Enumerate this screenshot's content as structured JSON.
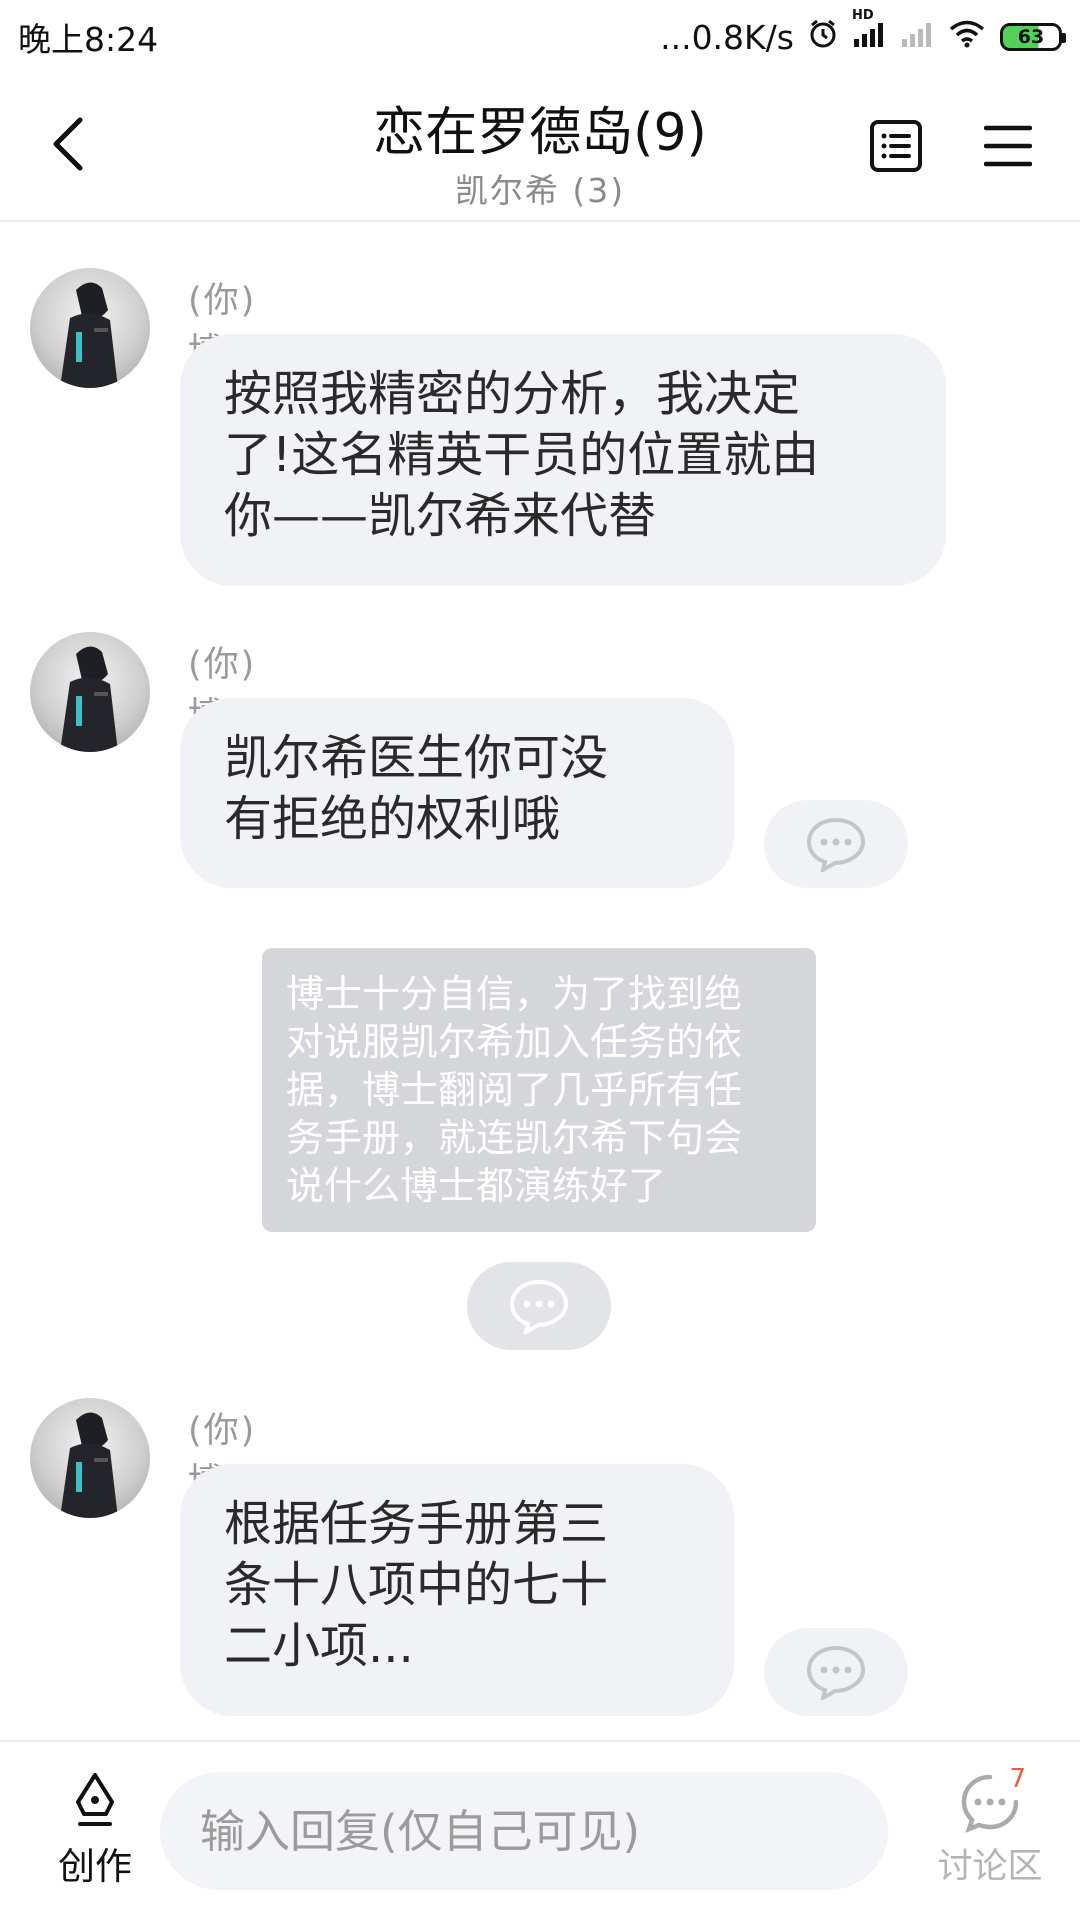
{
  "status_bar": {
    "time": "晚上8:24",
    "network_speed": "...0.8K/s",
    "signal_tag": "HD",
    "battery": "63"
  },
  "header": {
    "title": "恋在罗德岛(9)",
    "subtitle": "凯尔希 (3)",
    "icons": {
      "back": "back-arrow-icon",
      "list": "list-icon",
      "menu": "menu-icon"
    }
  },
  "messages": [
    {
      "sender": "(你) 博士",
      "text_lines": [
        "按照我精密的分析，我决定",
        "了!这名精英干员的位置就由",
        "你——凯尔希来代替"
      ]
    },
    {
      "sender": "(你) 博士",
      "text_lines": [
        "凯尔希医生你可没",
        "有拒绝的权利哦"
      ]
    },
    {
      "sender": "(你) 博士",
      "text_lines": [
        "根据任务手册第三",
        "条十八项中的七十",
        "二小项..."
      ]
    }
  ],
  "narration": {
    "text_lines": [
      "博士十分自信，为了找到绝",
      "对说服凯尔希加入任务的依",
      "据，博士翻阅了几乎所有任",
      "务手册，就连凯尔希下句会",
      "说什么博士都演练好了"
    ]
  },
  "bottom_bar": {
    "create_label": "创作",
    "reply_placeholder": "输入回复(仅自己可见)",
    "discuss_label": "讨论区",
    "discuss_badge": "7"
  },
  "colors": {
    "bubble_bg": "#f1f2f6",
    "narration_bg": "#d5d6da",
    "badge": "#ee5a3a",
    "battery_fill": "#54d05a"
  }
}
